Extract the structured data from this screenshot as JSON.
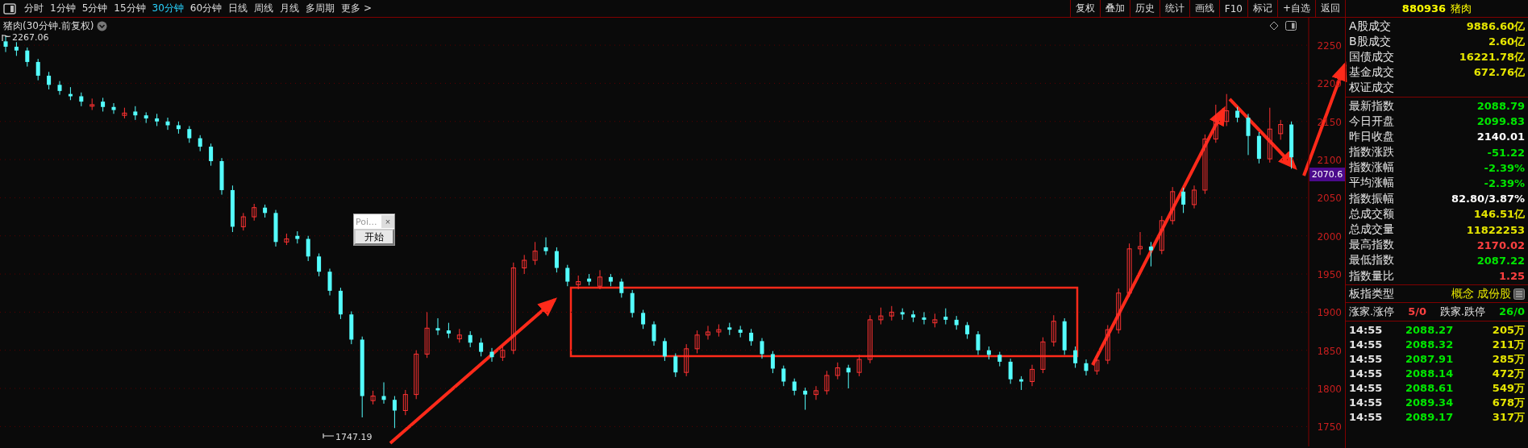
{
  "toolbar": {
    "periods": [
      {
        "label": "分时",
        "selected": false
      },
      {
        "label": "1分钟",
        "selected": false
      },
      {
        "label": "5分钟",
        "selected": false
      },
      {
        "label": "15分钟",
        "selected": false
      },
      {
        "label": "30分钟",
        "selected": true
      },
      {
        "label": "60分钟",
        "selected": false
      },
      {
        "label": "日线",
        "selected": false
      },
      {
        "label": "周线",
        "selected": false
      },
      {
        "label": "月线",
        "selected": false
      },
      {
        "label": "多周期",
        "selected": false
      },
      {
        "label": "更多 >",
        "selected": false
      }
    ],
    "buttons": [
      "复权",
      "叠加",
      "历史",
      "统计",
      "画线",
      "F10",
      "标记",
      "+自选",
      "返回"
    ]
  },
  "chart": {
    "title": "猪肉(30分钟.前复权)",
    "high_label": "2267.06",
    "low_label": "1747.19",
    "chart_data": {
      "type": "candlestick",
      "grid": true,
      "ylim": [
        1724,
        2286
      ],
      "yticks": [
        2250,
        2200,
        2150,
        2100,
        2050,
        2000,
        1950,
        1900,
        1850,
        1800,
        1750
      ],
      "ohlc": [
        [
          2255,
          2262,
          2241,
          2248
        ],
        [
          2248,
          2254,
          2236,
          2243
        ],
        [
          2243,
          2247,
          2222,
          2228
        ],
        [
          2228,
          2232,
          2204,
          2210
        ],
        [
          2210,
          2215,
          2192,
          2198
        ],
        [
          2198,
          2203,
          2185,
          2190
        ],
        [
          2186,
          2195,
          2178,
          2183
        ],
        [
          2183,
          2188,
          2170,
          2176
        ],
        [
          2170,
          2180,
          2165,
          2172
        ],
        [
          2176,
          2181,
          2163,
          2169
        ],
        [
          2169,
          2174,
          2160,
          2165
        ],
        [
          2158,
          2168,
          2154,
          2161
        ],
        [
          2163,
          2170,
          2152,
          2158
        ],
        [
          2158,
          2162,
          2148,
          2154
        ],
        [
          2154,
          2160,
          2144,
          2150
        ],
        [
          2150,
          2155,
          2139,
          2145
        ],
        [
          2145,
          2150,
          2134,
          2140
        ],
        [
          2140,
          2144,
          2122,
          2128
        ],
        [
          2128,
          2132,
          2111,
          2117
        ],
        [
          2117,
          2121,
          2092,
          2098
        ],
        [
          2098,
          2102,
          2054,
          2060
        ],
        [
          2060,
          2066,
          2005,
          2012
        ],
        [
          2012,
          2030,
          2007,
          2025
        ],
        [
          2025,
          2042,
          2020,
          2037
        ],
        [
          2037,
          2041,
          2024,
          2030
        ],
        [
          2030,
          2034,
          1986,
          1992
        ],
        [
          1992,
          2003,
          1988,
          1996
        ],
        [
          2000,
          2006,
          1990,
          1996
        ],
        [
          1996,
          2000,
          1967,
          1973
        ],
        [
          1973,
          1977,
          1947,
          1953
        ],
        [
          1953,
          1957,
          1922,
          1928
        ],
        [
          1928,
          1932,
          1891,
          1897
        ],
        [
          1897,
          1901,
          1858,
          1864
        ],
        [
          1864,
          1868,
          1762,
          1790
        ],
        [
          1784,
          1797,
          1779,
          1790
        ],
        [
          1790,
          1808,
          1780,
          1785
        ],
        [
          1785,
          1790,
          1748,
          1771
        ],
        [
          1771,
          1798,
          1765,
          1792
        ],
        [
          1792,
          1850,
          1786,
          1845
        ],
        [
          1845,
          1900,
          1840,
          1879
        ],
        [
          1879,
          1892,
          1870,
          1876
        ],
        [
          1876,
          1886,
          1866,
          1872
        ],
        [
          1865,
          1878,
          1860,
          1870
        ],
        [
          1870,
          1875,
          1854,
          1860
        ],
        [
          1860,
          1866,
          1842,
          1848
        ],
        [
          1848,
          1853,
          1835,
          1841
        ],
        [
          1841,
          1856,
          1836,
          1850
        ],
        [
          1850,
          1965,
          1845,
          1958
        ],
        [
          1958,
          1975,
          1950,
          1968
        ],
        [
          1968,
          1992,
          1962,
          1980
        ],
        [
          1985,
          1998,
          1975,
          1980
        ],
        [
          1980,
          1985,
          1952,
          1958
        ],
        [
          1958,
          1962,
          1934,
          1940
        ],
        [
          1936,
          1948,
          1930,
          1940
        ],
        [
          1944,
          1950,
          1935,
          1940
        ],
        [
          1934,
          1955,
          1930,
          1946
        ],
        [
          1946,
          1950,
          1934,
          1940
        ],
        [
          1940,
          1944,
          1919,
          1925
        ],
        [
          1925,
          1929,
          1893,
          1899
        ],
        [
          1899,
          1903,
          1878,
          1884
        ],
        [
          1884,
          1888,
          1856,
          1862
        ],
        [
          1862,
          1866,
          1836,
          1842
        ],
        [
          1842,
          1846,
          1815,
          1821
        ],
        [
          1821,
          1858,
          1816,
          1852
        ],
        [
          1852,
          1876,
          1846,
          1870
        ],
        [
          1870,
          1882,
          1864,
          1874
        ],
        [
          1874,
          1884,
          1868,
          1877
        ],
        [
          1880,
          1886,
          1870,
          1877
        ],
        [
          1877,
          1882,
          1867,
          1873
        ],
        [
          1873,
          1878,
          1856,
          1862
        ],
        [
          1862,
          1866,
          1839,
          1845
        ],
        [
          1845,
          1849,
          1820,
          1826
        ],
        [
          1826,
          1830,
          1803,
          1809
        ],
        [
          1809,
          1813,
          1791,
          1797
        ],
        [
          1797,
          1801,
          1772,
          1792
        ],
        [
          1792,
          1803,
          1785,
          1797
        ],
        [
          1797,
          1823,
          1792,
          1817
        ],
        [
          1817,
          1834,
          1812,
          1827
        ],
        [
          1827,
          1831,
          1800,
          1821
        ],
        [
          1821,
          1844,
          1816,
          1838
        ],
        [
          1838,
          1896,
          1833,
          1890
        ],
        [
          1890,
          1906,
          1884,
          1895
        ],
        [
          1895,
          1908,
          1889,
          1900
        ],
        [
          1900,
          1905,
          1890,
          1897
        ],
        [
          1897,
          1902,
          1887,
          1893
        ],
        [
          1893,
          1900,
          1884,
          1890
        ],
        [
          1886,
          1898,
          1880,
          1890
        ],
        [
          1894,
          1905,
          1884,
          1890
        ],
        [
          1890,
          1895,
          1877,
          1883
        ],
        [
          1883,
          1887,
          1865,
          1871
        ],
        [
          1871,
          1875,
          1844,
          1850
        ],
        [
          1850,
          1855,
          1838,
          1844
        ],
        [
          1844,
          1848,
          1829,
          1835
        ],
        [
          1835,
          1839,
          1806,
          1812
        ],
        [
          1812,
          1816,
          1798,
          1809
        ],
        [
          1809,
          1831,
          1803,
          1825
        ],
        [
          1825,
          1867,
          1820,
          1861
        ],
        [
          1861,
          1896,
          1855,
          1888
        ],
        [
          1888,
          1892,
          1844,
          1850
        ],
        [
          1850,
          1855,
          1827,
          1833
        ],
        [
          1833,
          1838,
          1817,
          1823
        ],
        [
          1823,
          1843,
          1818,
          1837
        ],
        [
          1837,
          1883,
          1832,
          1877
        ],
        [
          1877,
          1931,
          1872,
          1925
        ],
        [
          1925,
          1990,
          1920,
          1983
        ],
        [
          1983,
          2005,
          1975,
          1986
        ],
        [
          1986,
          1992,
          1960,
          1981
        ],
        [
          1981,
          2026,
          1976,
          2020
        ],
        [
          2020,
          2064,
          2015,
          2058
        ],
        [
          2058,
          2063,
          2030,
          2041
        ],
        [
          2041,
          2066,
          2036,
          2060
        ],
        [
          2060,
          2133,
          2055,
          2127
        ],
        [
          2127,
          2172,
          2122,
          2150
        ],
        [
          2150,
          2186,
          2144,
          2164
        ],
        [
          2164,
          2169,
          2149,
          2155
        ],
        [
          2155,
          2160,
          2106,
          2131
        ],
        [
          2131,
          2136,
          2095,
          2101
        ],
        [
          2101,
          2168,
          2096,
          2140
        ],
        [
          2134,
          2152,
          2126,
          2146
        ],
        [
          2146,
          2150,
          2088,
          2103
        ]
      ]
    },
    "current_price": "2070.6"
  },
  "popup": {
    "title": "Poi...",
    "close": "×",
    "button": "开始"
  },
  "panel": {
    "code": "880936",
    "name": "猪肉",
    "turnover": [
      {
        "label": "A股成交",
        "value": "9886.60亿",
        "color": "#e6e600"
      },
      {
        "label": "B股成交",
        "value": "2.60亿",
        "color": "#e6e600"
      },
      {
        "label": "国债成交",
        "value": "16221.78亿",
        "color": "#e6e600"
      },
      {
        "label": "基金成交",
        "value": "672.76亿",
        "color": "#e6e600"
      },
      {
        "label": "权证成交"
      }
    ],
    "stats": [
      {
        "label": "最新指数",
        "value": "2088.79",
        "color": "#00e600"
      },
      {
        "label": "今日开盘",
        "value": "2099.83",
        "color": "#00e600"
      },
      {
        "label": "昨日收盘",
        "value": "2140.01",
        "color": "#ffffff"
      },
      {
        "label": "指数涨跌",
        "value": "-51.22",
        "color": "#00e600"
      },
      {
        "label": "指数涨幅",
        "value": "-2.39%",
        "color": "#00e600"
      },
      {
        "label": "平均涨幅",
        "value": "-2.39%",
        "color": "#00e600"
      },
      {
        "label": "指数振幅",
        "value": "82.80/3.87%",
        "color": "#ffffff"
      },
      {
        "label": "总成交额",
        "value": "146.51亿",
        "color": "#e6e600"
      },
      {
        "label": "总成交量",
        "value": "11822253",
        "color": "#e6e600"
      },
      {
        "label": "最高指数",
        "value": "2170.02",
        "color": "#ff4040"
      },
      {
        "label": "最低指数",
        "value": "2087.22",
        "color": "#00e600"
      },
      {
        "label": "指数量比",
        "value": "1.25",
        "color": "#ff4040"
      }
    ],
    "type_label": "板指类型",
    "type_value": "概念 成份股",
    "breadth": {
      "up_label": "涨家.涨停",
      "up_value": "5/0",
      "down_label": "跌家.跌停",
      "down_value": "26/0"
    },
    "ticks": [
      {
        "time": "14:55",
        "price": "2088.27",
        "volume": "205万"
      },
      {
        "time": "14:55",
        "price": "2088.32",
        "volume": "211万"
      },
      {
        "time": "14:55",
        "price": "2087.91",
        "volume": "285万"
      },
      {
        "time": "14:55",
        "price": "2088.14",
        "volume": "472万"
      },
      {
        "time": "14:55",
        "price": "2088.61",
        "volume": "549万"
      },
      {
        "time": "14:55",
        "price": "2089.34",
        "volume": "678万"
      },
      {
        "time": "14:55",
        "price": "2089.17",
        "volume": "317万"
      }
    ]
  }
}
